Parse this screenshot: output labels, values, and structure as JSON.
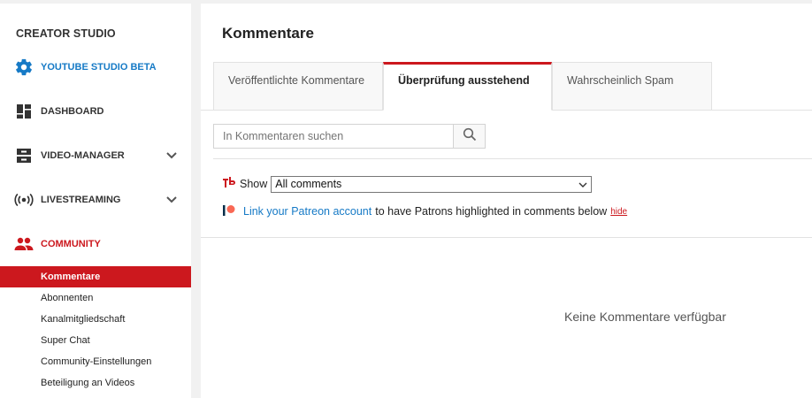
{
  "sidebar": {
    "title": "CREATOR STUDIO",
    "items": [
      {
        "label": "YOUTUBE STUDIO BETA",
        "icon": "gear-icon"
      },
      {
        "label": "DASHBOARD",
        "icon": "dashboard-icon"
      },
      {
        "label": "VIDEO-MANAGER",
        "icon": "video-manager-icon"
      },
      {
        "label": "LIVESTREAMING",
        "icon": "livestream-icon"
      },
      {
        "label": "COMMUNITY",
        "icon": "community-icon"
      }
    ],
    "community_subitems": [
      "Kommentare",
      "Abonnenten",
      "Kanalmitgliedschaft",
      "Super Chat",
      "Community-Einstellungen",
      "Beteiligung an Videos"
    ],
    "active_subitem": "Kommentare"
  },
  "main": {
    "title": "Kommentare",
    "tabs": [
      {
        "label": "Veröffentlichte Kommentare",
        "active": false
      },
      {
        "label": "Überprüfung ausstehend",
        "active": true
      },
      {
        "label": "Wahrscheinlich Spam",
        "active": false
      }
    ],
    "search": {
      "placeholder": "In Kommentaren suchen"
    },
    "filter": {
      "label": "Show",
      "selected": "All comments"
    },
    "patreon": {
      "link": "Link your Patreon account",
      "text": "to have Patrons highlighted in comments below",
      "hide": "hide"
    },
    "empty_message": "Keine Kommentare verfügbar"
  },
  "colors": {
    "accent_red": "#cc181e",
    "link_blue": "#167ac6"
  }
}
